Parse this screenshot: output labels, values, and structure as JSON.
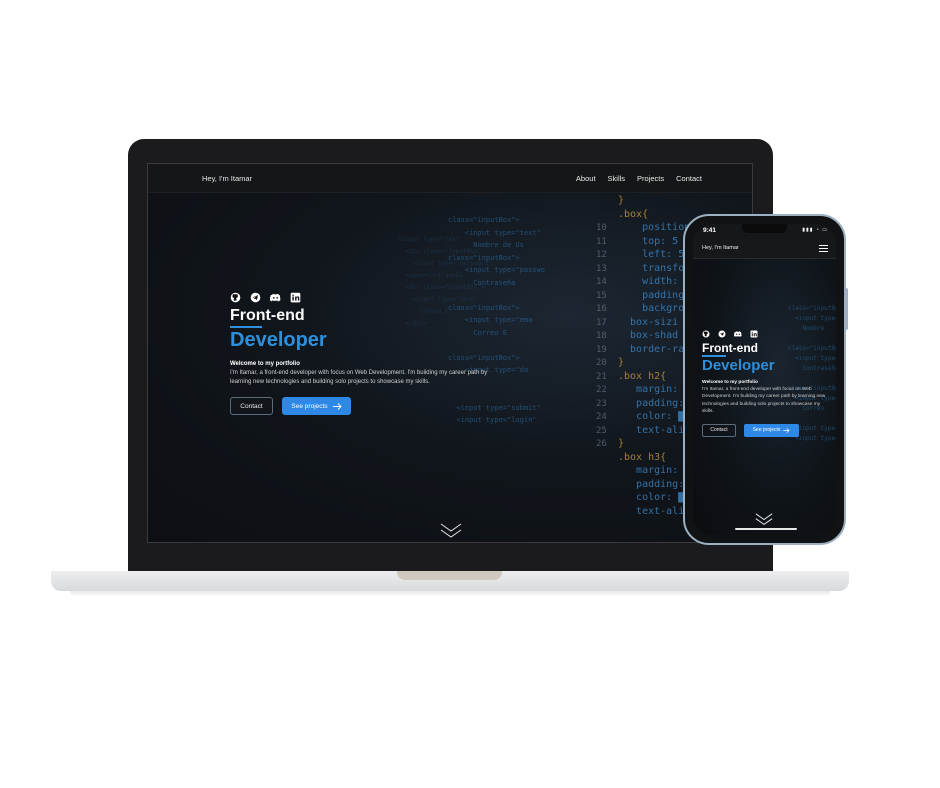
{
  "desktop": {
    "brand": "Hey, I'm Itamar",
    "nav": [
      "About",
      "Skills",
      "Projects",
      "Contact"
    ],
    "social_icons": [
      "github-icon",
      "telegram-icon",
      "discord-icon",
      "linkedin-icon"
    ],
    "title_line1": "Front-end",
    "title_line2": "Developer",
    "welcome": "Welcome to my portfolio",
    "description": "I'm Itamar, a front-end developer with focus on Web Development. I'm building my career path by learning new technologies and building solo projects to showcase my skills.",
    "contact_button": "Contact",
    "projects_button": "See projects"
  },
  "phone": {
    "time": "9:41",
    "brand": "Hey, I'm Itamar",
    "title_line1": "Front-end",
    "title_line2": "Developer",
    "welcome": "Welcome to my portfolio",
    "description": "I'm Itamar, a front-end developer with focus on Web Development. I'm building my career path by learning new technologies and building solo projects to showcase my skills.",
    "contact_button": "Contact",
    "projects_button": "See projects"
  },
  "colors": {
    "accent": "#2e88e6",
    "title_blue": "#2c8fdc",
    "background": "#0c0f13"
  }
}
